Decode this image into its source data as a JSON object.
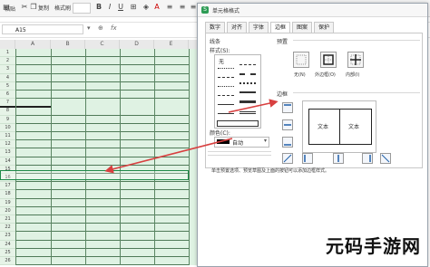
{
  "toolbar": {
    "paste": "粘贴",
    "copy": "复制",
    "format_painter": "格式刷",
    "bold": "B",
    "italic": "I",
    "underline": "U"
  },
  "formula_bar": {
    "name_box": "A15",
    "fx": "fx"
  },
  "columns": [
    "A",
    "B",
    "C",
    "D",
    "E"
  ],
  "rows": [
    "1",
    "2",
    "3",
    "4",
    "5",
    "6",
    "7",
    "8",
    "9",
    "10",
    "11",
    "12",
    "13",
    "14",
    "15",
    "16",
    "17",
    "18",
    "19",
    "20",
    "21",
    "22",
    "23",
    "24",
    "25",
    "26"
  ],
  "dialog": {
    "title": "单元格格式",
    "tabs": [
      "数字",
      "对齐",
      "字体",
      "边框",
      "图案",
      "保护"
    ],
    "active_tab": "边框",
    "line_group": "线条",
    "style_label": "样式(S):",
    "none_label": "无",
    "color_label": "颜色(C):",
    "color_value": "自动",
    "preset_group": "预置",
    "preset_none": "无(N)",
    "preset_outline": "外边框(O)",
    "preset_inside": "内部(I)",
    "border_group": "边框",
    "preview_text_left": "文本",
    "preview_text_right": "文本",
    "hint": "单击预置选项、预览草图及上面的按钮可以添加边框样式。"
  },
  "watermark": "元码手游网",
  "colors": {
    "selection": "#1e8a48",
    "sheet_bg": "#dff2e3",
    "arrow": "#d84040"
  }
}
